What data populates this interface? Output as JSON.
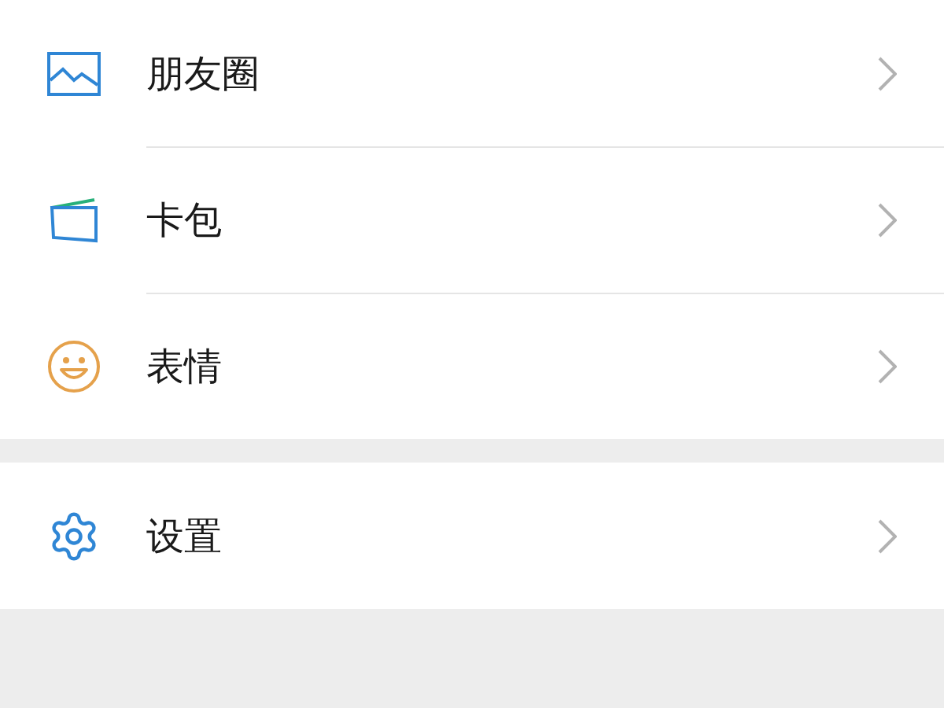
{
  "groups": [
    {
      "items": [
        {
          "kind": "photo",
          "label": "朋友圈"
        },
        {
          "kind": "wallet",
          "label": "卡包"
        },
        {
          "kind": "smile",
          "label": "表情"
        }
      ]
    },
    {
      "items": [
        {
          "kind": "gear",
          "label": "设置"
        }
      ]
    }
  ]
}
